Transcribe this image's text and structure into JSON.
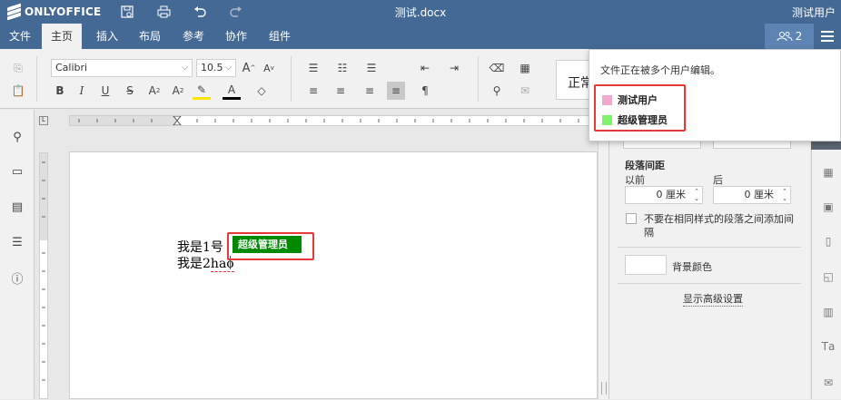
{
  "app": {
    "logo_text": "ONLYOFFICE",
    "doc_title": "测试.docx",
    "current_user": "测试用户"
  },
  "menu": {
    "tabs": [
      {
        "label": "文件"
      },
      {
        "label": "主页",
        "active": true
      },
      {
        "label": "插入"
      },
      {
        "label": "布局"
      },
      {
        "label": "参考"
      },
      {
        "label": "协作"
      },
      {
        "label": "组件"
      }
    ],
    "users_count": "2"
  },
  "toolbar": {
    "font_name": "Calibri",
    "font_size": "10.5",
    "style_preview": "正常"
  },
  "document": {
    "line1": "我是1号",
    "line2_prefix": "我是2",
    "line2_suffix": "hao",
    "editor_tag": "超级管理员",
    "editor_tag_color": "#008a00"
  },
  "right_panel": {
    "section_title": "段落间距",
    "before_label": "以前",
    "after_label": "后",
    "before_value": "0 厘米",
    "after_value": "0 厘米",
    "no_space_label": "不要在相同样式的段落之间添加间隔",
    "bg_color_label": "背景颜色",
    "advanced_link": "显示高级设置"
  },
  "users_popup": {
    "message": "文件正在被多个用户编辑。",
    "users": [
      {
        "name": "测试用户",
        "color": "#f4a7cf"
      },
      {
        "name": "超级管理员",
        "color": "#7df26a"
      }
    ]
  },
  "colors": {
    "header": "#446995",
    "highlight_border": "#e53935"
  }
}
